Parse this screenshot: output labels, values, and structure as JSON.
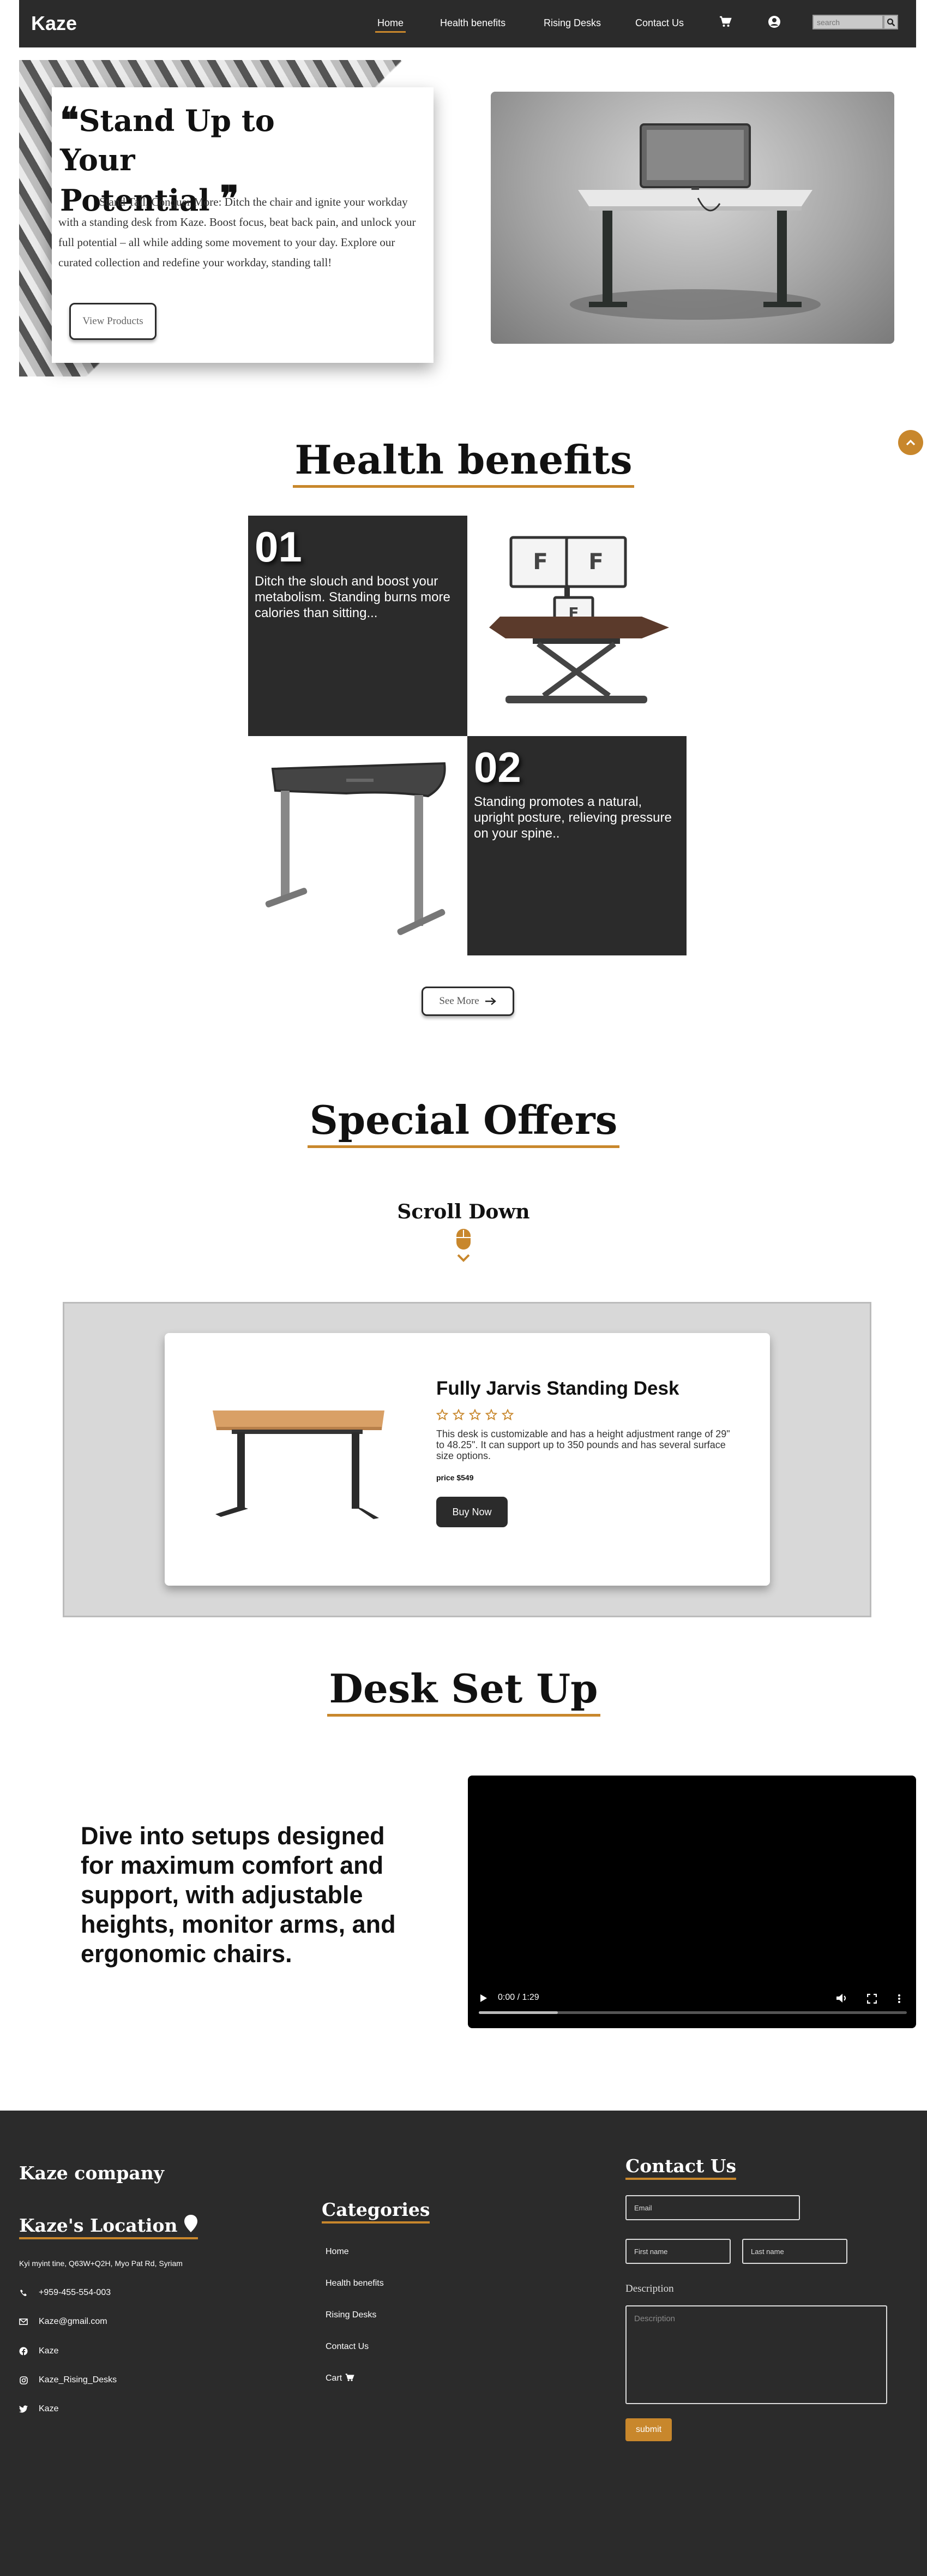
{
  "nav": {
    "brand": "Kaze",
    "links": [
      "Home",
      "Health benefits",
      "Rising Desks",
      "Contact Us"
    ],
    "search_placeholder": "search",
    "accent": "#c8872c"
  },
  "hero": {
    "title_line1": "Stand Up to Your",
    "title_line2": "Potential",
    "text": "Stand Tall, Conquer More: Ditch the chair and ignite your workday with a standing desk from Kaze. Boost focus, beat back pain, and unlock your full potential – all while adding some movement to your day. Explore our curated collection and redefine your workday, standing tall!",
    "button": "View Products"
  },
  "health": {
    "heading": "Health benefits",
    "items": [
      {
        "num": "01",
        "text": "Ditch the slouch and boost your metabolism. Standing burns more calories than sitting..."
      },
      {
        "num": "02",
        "text": "Standing promotes a natural, upright posture, relieving pressure on your spine.."
      }
    ],
    "see_more": "See More"
  },
  "offers": {
    "heading": "Special Offers",
    "scroll": "Scroll Down",
    "product": {
      "title": "Fully Jarvis Standing Desk",
      "rating": 0,
      "stars": 5,
      "desc": "This desk is customizable and has a height adjustment range of 29\" to 48.25\". It can support up to 350 pounds and has several surface size options.",
      "price": "price $549",
      "button": "Buy Now"
    }
  },
  "setup": {
    "heading": "Desk Set Up",
    "text": "Dive into setups designed for maximum comfort and support, with adjustable heights, monitor arms, and ergonomic chairs.",
    "video_time": "0:00 / 1:29",
    "video_progress": 0.0
  },
  "footer": {
    "company": "Kaze company",
    "location_heading": "Kaze's Location",
    "address": "Kyi myint tine, Q63W+Q2H, Myo Pat Rd, Syriam",
    "contacts": [
      "+959-455-554-003",
      "Kaze@gmail.com",
      "Kaze",
      "Kaze_Rising_Desks",
      "Kaze"
    ],
    "categories_heading": "Categories",
    "categories": [
      "Home",
      "Health benefits",
      "Rising Desks",
      "Contact Us",
      "Cart"
    ],
    "contact_heading": "Contact Us",
    "email_placeholder": "Email",
    "first_placeholder": "First name",
    "last_placeholder": "Last name",
    "desc_label": "Description",
    "desc_placeholder": "Description",
    "submit": "submit"
  }
}
